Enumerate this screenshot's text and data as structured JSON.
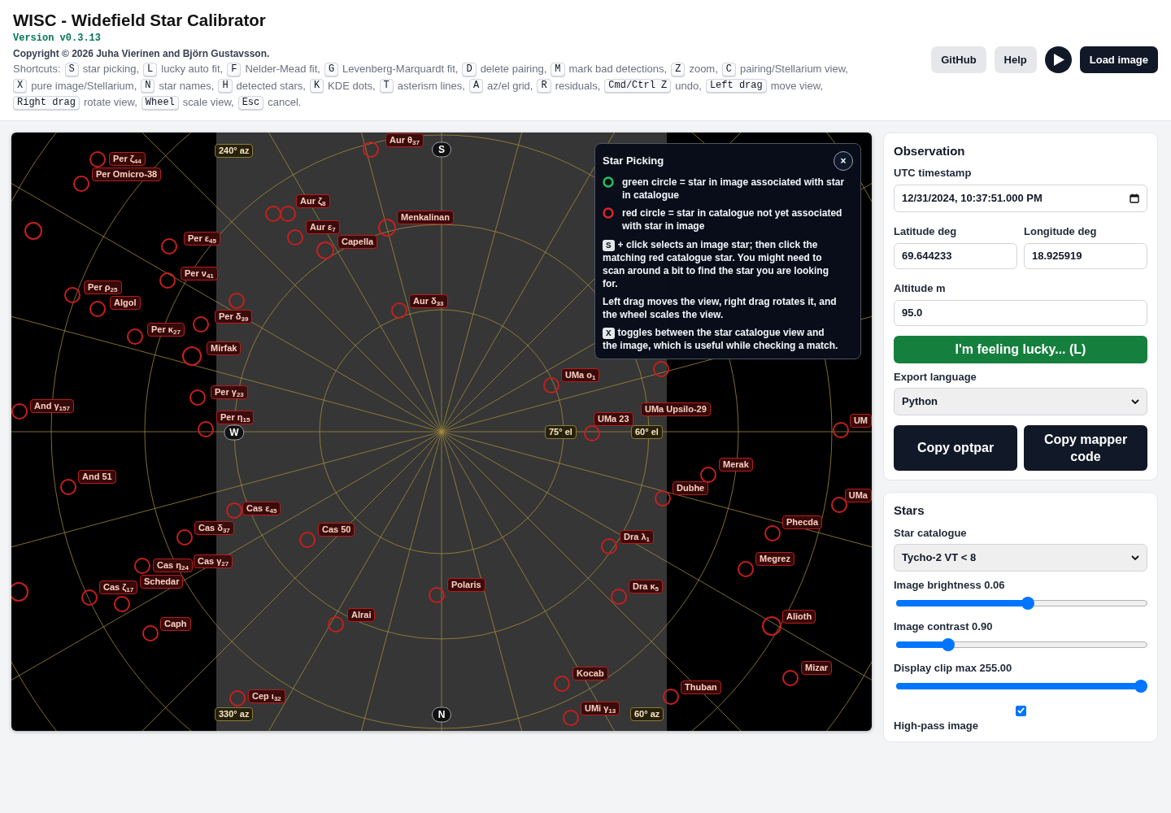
{
  "header": {
    "title": "WISC - Widefield Star Calibrator",
    "version": "Version v0.3.13",
    "copyright": "Copyright © 2026 Juha Vierinen and Björn Gustavsson.",
    "shortcuts": {
      "label": "Shortcuts:",
      "items": [
        {
          "key": "S",
          "action": "star picking,"
        },
        {
          "key": "L",
          "action": "lucky auto fit,"
        },
        {
          "key": "F",
          "action": "Nelder-Mead fit,"
        },
        {
          "key": "G",
          "action": "Levenberg-Marquardt fit,"
        },
        {
          "key": "D",
          "action": "delete pairing,"
        },
        {
          "key": "M",
          "action": "mark bad detections,"
        },
        {
          "key": "Z",
          "action": "zoom,"
        },
        {
          "key": "C",
          "action": "pairing/Stellarium view,"
        },
        {
          "key": "X",
          "action": "pure image/Stellarium,"
        },
        {
          "key": "N",
          "action": "star names,"
        },
        {
          "key": "H",
          "action": "detected stars,"
        },
        {
          "key": "K",
          "action": "KDE dots,"
        },
        {
          "key": "T",
          "action": "asterism lines,"
        },
        {
          "key": "A",
          "action": "az/el grid,"
        },
        {
          "key": "R",
          "action": "residuals,"
        },
        {
          "key": "Cmd/Ctrl Z",
          "action": "undo,"
        },
        {
          "key": "Left drag",
          "action": "move view,"
        },
        {
          "key": "Right drag",
          "action": "rotate view,"
        },
        {
          "key": "Wheel",
          "action": "scale view,"
        },
        {
          "key": "Esc",
          "action": "cancel."
        }
      ]
    },
    "buttons": [
      {
        "kind": "secondary",
        "label": "GitHub"
      },
      {
        "kind": "secondary",
        "label": "Help"
      },
      {
        "kind": "play"
      },
      {
        "kind": "primary",
        "label": "Load image"
      }
    ]
  },
  "sky_view": {
    "star_labels": [
      "Per ζ$_{44}$",
      "Per Omicro-38",
      "Per ε$_{45}$",
      "Per ν$_{41}$",
      "Per ρ$_{25}$",
      "Algol",
      "Per κ$_{27}$",
      "Per δ$_{39}$",
      "Mirfak",
      "Per γ$_{23}$",
      "And γ$_{157}$",
      "Per η$_{15}$",
      "Aur θ$_{37}$",
      "Aur ζ$_{8}$",
      "Aur ε$_{7}$",
      "Capella",
      "Menkalinan",
      "Aur δ$_{33}$",
      "And 51",
      "Cas ε$_{45}$",
      "Cas δ$_{37}$",
      "Cas 50",
      "Cas γ$_{27}$",
      "Cas η$_{24}$",
      "Schedar",
      "Cas ζ$_{17}$",
      "Caph",
      "Alrai",
      "Polaris",
      "Cep ι$_{32}$",
      "UMa ο$_{1}$",
      "UMa Upsilo-29",
      "UMa 23",
      "UM",
      "Merak",
      "Dubhe",
      "UMa",
      "Phecda",
      "Megrez",
      "Dra λ$_{1}$",
      "Dra κ$_{5}$",
      "Alioth",
      "Mizar",
      "Thuban",
      "Kocab",
      "UMi γ$_{13}$"
    ],
    "grid_labels": [
      "240° az",
      "75° el",
      "60° el",
      "330° az",
      "60° az"
    ],
    "compass": [
      "S",
      "W",
      "N"
    ],
    "help_panel": {
      "title": "Star Picking",
      "close": "×",
      "legend": [
        {
          "color": "#22c55e",
          "text": "green circle = star in image associated with star in catalogue"
        },
        {
          "color": "#dc2626",
          "text": "red circle = star in catalogue not yet associated with star in image"
        }
      ],
      "paragraphs": [
        {
          "key": "S",
          "text": "+ click selects an image star; then click the matching red catalogue star. You might need to scan around a bit to find the star you are looking for."
        },
        {
          "text": "Left drag moves the view, right drag rotates it, and the wheel scales the view."
        },
        {
          "key": "X",
          "text": "toggles between the star catalogue view and the image, which is useful while checking a match."
        }
      ]
    }
  },
  "observation": {
    "title": "Observation",
    "timestamp": {
      "label": "UTC timestamp",
      "value": "12/31/2024, 10:37:51.000 PM"
    },
    "latitude": {
      "label": "Latitude deg",
      "value": "69.644233"
    },
    "longitude": {
      "label": "Longitude deg",
      "value": "18.925919"
    },
    "altitude": {
      "label": "Altitude m",
      "value": "95.0"
    },
    "lucky_button": "I'm feeling lucky... (L)",
    "export_language": {
      "label": "Export language",
      "value": "Python"
    },
    "copy_buttons": [
      "Copy optpar",
      "Copy mapper code"
    ]
  },
  "stars": {
    "title": "Stars",
    "catalogue": {
      "label": "Star catalogue",
      "value": "Tycho-2 VT < 8"
    },
    "sliders": [
      {
        "label": "Image brightness 0.06",
        "level": 0.53
      },
      {
        "label": "Image contrast 0.90",
        "level": 0.2
      },
      {
        "label": "Display clip max 255.00",
        "level": 1
      }
    ],
    "high_pass": {
      "label": "High-pass image",
      "checked": true
    }
  }
}
